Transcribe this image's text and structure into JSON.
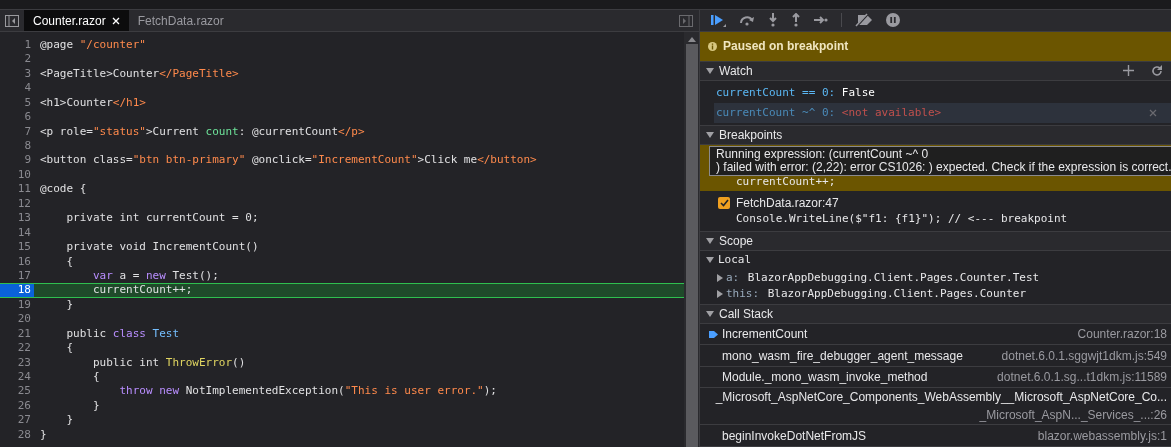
{
  "editor": {
    "tabs": [
      {
        "label": "Counter.razor",
        "selected": true,
        "closable": true
      },
      {
        "label": "FetchData.razor",
        "selected": false,
        "closable": false
      }
    ],
    "lines": [
      {
        "number": "1",
        "current": false,
        "segments": [
          {
            "text": "@page ",
            "kind": "plain"
          },
          {
            "text": "\"/counter\"",
            "kind": "string"
          }
        ]
      },
      {
        "number": "2",
        "current": false
      },
      {
        "number": "3",
        "current": false,
        "segments": [
          {
            "text": "<PageTitle>Counter",
            "kind": "plain"
          },
          {
            "text": "</PageTitle>",
            "kind": "string"
          }
        ]
      },
      {
        "number": "4",
        "current": false
      },
      {
        "number": "5",
        "current": false,
        "segments": [
          {
            "text": "<h1>Counter",
            "kind": "plain"
          },
          {
            "text": "</h1>",
            "kind": "string"
          }
        ]
      },
      {
        "number": "6",
        "current": false
      },
      {
        "number": "7",
        "current": false,
        "segments": [
          {
            "text": "<p role=",
            "kind": "plain"
          },
          {
            "text": "\"status\"",
            "kind": "string"
          },
          {
            "text": ">Current ",
            "kind": "plain"
          },
          {
            "text": "count",
            "kind": "identifier"
          },
          {
            "text": ": @currentCount",
            "kind": "plain"
          },
          {
            "text": "</p>",
            "kind": "string"
          }
        ]
      },
      {
        "number": "8",
        "current": false
      },
      {
        "number": "9",
        "current": false,
        "segments": [
          {
            "text": "<button class=",
            "kind": "plain"
          },
          {
            "text": "\"btn btn-primary\"",
            "kind": "string"
          },
          {
            "text": " @onclick=",
            "kind": "plain"
          },
          {
            "text": "\"IncrementCount\"",
            "kind": "string"
          },
          {
            "text": ">Click me",
            "kind": "plain"
          },
          {
            "text": "</button>",
            "kind": "string"
          }
        ]
      },
      {
        "number": "10",
        "current": false
      },
      {
        "number": "11",
        "current": false,
        "segments": [
          {
            "text": "@code {",
            "kind": "plain"
          }
        ]
      },
      {
        "number": "12",
        "current": false
      },
      {
        "number": "13",
        "current": false,
        "segments": [
          {
            "text": "    private int currentCount = 0;",
            "kind": "plain"
          }
        ]
      },
      {
        "number": "14",
        "current": false
      },
      {
        "number": "15",
        "current": false,
        "segments": [
          {
            "text": "    private void IncrementCount()",
            "kind": "plain"
          }
        ]
      },
      {
        "number": "16",
        "current": false,
        "segments": [
          {
            "text": "    {",
            "kind": "plain"
          }
        ]
      },
      {
        "number": "17",
        "current": false,
        "segments": [
          {
            "text": "        var",
            "kind": "keyword"
          },
          {
            "text": " a = ",
            "kind": "plain"
          },
          {
            "text": "new",
            "kind": "keyword"
          },
          {
            "text": " Test();",
            "kind": "plain"
          }
        ]
      },
      {
        "number": "18",
        "current": true,
        "segments": [
          {
            "text": "        currentCount++;",
            "kind": "plain"
          }
        ]
      },
      {
        "number": "19",
        "current": false,
        "segments": [
          {
            "text": "    }",
            "kind": "plain"
          }
        ]
      },
      {
        "number": "20",
        "current": false
      },
      {
        "number": "21",
        "current": false,
        "segments": [
          {
            "text": "    public ",
            "kind": "plain"
          },
          {
            "text": "class",
            "kind": "keyword"
          },
          {
            "text": " Test",
            "kind": "type"
          }
        ]
      },
      {
        "number": "22",
        "current": false,
        "segments": [
          {
            "text": "    {",
            "kind": "plain"
          }
        ]
      },
      {
        "number": "23",
        "current": false,
        "segments": [
          {
            "text": "        public int ",
            "kind": "plain"
          },
          {
            "text": "ThrowError",
            "kind": "method"
          },
          {
            "text": "()",
            "kind": "plain"
          }
        ]
      },
      {
        "number": "24",
        "current": false,
        "segments": [
          {
            "text": "        {",
            "kind": "plain"
          }
        ]
      },
      {
        "number": "25",
        "current": false,
        "segments": [
          {
            "text": "            throw",
            "kind": "keyword"
          },
          {
            "text": " new",
            "kind": "keyword"
          },
          {
            "text": " NotImplementedException(",
            "kind": "plain"
          },
          {
            "text": "\"This is user error.\"",
            "kind": "string"
          },
          {
            "text": ");",
            "kind": "plain"
          }
        ]
      },
      {
        "number": "26",
        "current": false,
        "segments": [
          {
            "text": "        }",
            "kind": "plain"
          }
        ]
      },
      {
        "number": "27",
        "current": false,
        "segments": [
          {
            "text": "    }",
            "kind": "plain"
          }
        ]
      },
      {
        "number": "28",
        "current": false,
        "segments": [
          {
            "text": "}",
            "kind": "plain"
          }
        ]
      }
    ]
  },
  "debugger": {
    "status": "Paused on breakpoint",
    "watch": {
      "title": "Watch",
      "expanded": true,
      "items": [
        {
          "expression": "currentCount == 0:",
          "value": "False",
          "error": false,
          "selected": false
        },
        {
          "expression": "currentCount ~^ 0:",
          "value": "<not available>",
          "error": true,
          "selected": true
        }
      ]
    },
    "breakpoints": {
      "title": "Breakpoints",
      "expanded": true,
      "items": [
        {
          "selected": true,
          "code": "currentCount++;"
        },
        {
          "checked": true,
          "selected": false,
          "location": "FetchData.razor:47",
          "code": "Console.WriteLine($\"f1: {f1}\"); // <--- breakpoint"
        }
      ]
    },
    "tooltip": [
      "Running expression: (currentCount ~^ 0",
      ") failed with error: (2,22): error CS1026: ) expected. Check if the expression is correct."
    ],
    "scope": {
      "title": "Scope",
      "expanded": true,
      "groups": [
        {
          "name": "Local",
          "expanded": true,
          "children": [
            {
              "name": "a:",
              "value": "BlazorAppDebugging.Client.Pages.Counter.Test",
              "expanded": false
            },
            {
              "name": "this:",
              "value": "BlazorAppDebugging.Client.Pages.Counter",
              "expanded": false
            }
          ]
        }
      ]
    },
    "call_stack": {
      "title": "Call Stack",
      "expanded": true,
      "frames": [
        {
          "name": "IncrementCount",
          "location": "Counter.razor:18",
          "selected": true,
          "wrapped": false
        },
        {
          "name": "mono_wasm_fire_debugger_agent_message",
          "location": "dotnet.6.0.1.sggwjt1dkm.js:549",
          "selected": false,
          "wrapped": false
        },
        {
          "name": "Module._mono_wasm_invoke_method",
          "location": "dotnet.6.0.1.sg...t1dkm.js:11589",
          "selected": false,
          "wrapped": false
        },
        {
          "name": "_Microsoft_AspNetCore_Components_WebAssembly__Microsoft_AspNetCore_Co...",
          "location": "_Microsoft_AspN..._Services_...:26",
          "selected": false,
          "wrapped": true
        },
        {
          "name": "beginInvokeDotNetFromJS",
          "location": "blazor.webassembly.js:1",
          "selected": false,
          "wrapped": false
        }
      ]
    }
  }
}
